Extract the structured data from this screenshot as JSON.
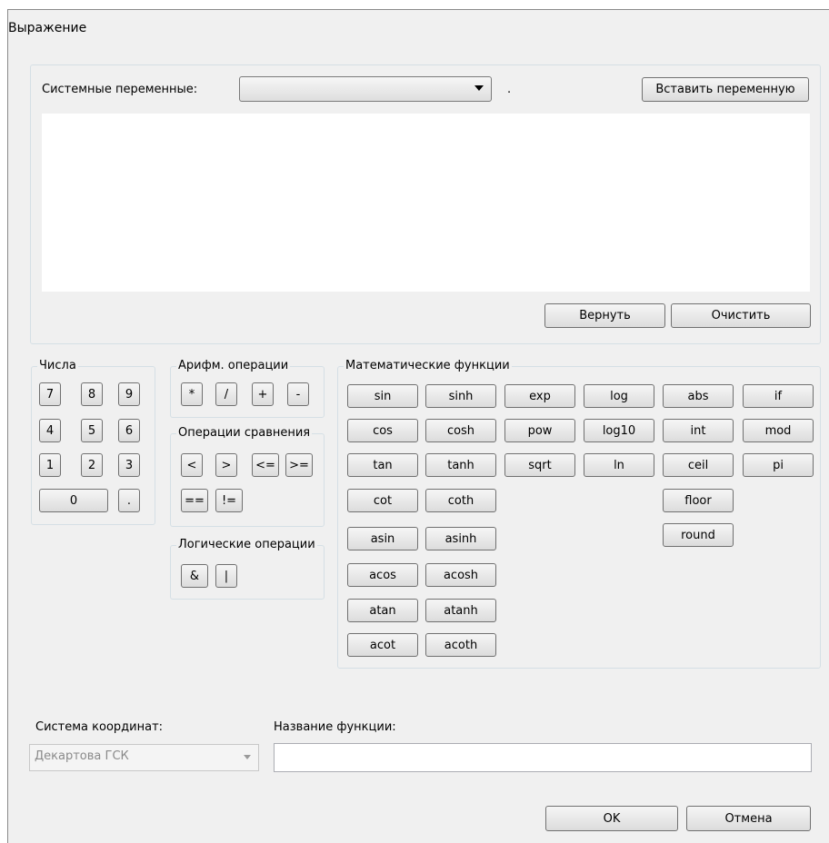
{
  "window": {
    "title": "Выражение"
  },
  "system_vars": {
    "label": "Системные переменные:",
    "selected": "",
    "dot": ".",
    "insert_button": "Вставить переменную"
  },
  "editor": {
    "value": ""
  },
  "actions": {
    "revert": "Вернуть",
    "clear": "Очистить"
  },
  "numbers": {
    "legend": "Числа",
    "keys": [
      "7",
      "8",
      "9",
      "4",
      "5",
      "6",
      "1",
      "2",
      "3",
      "0",
      "."
    ]
  },
  "arith": {
    "legend": "Арифм. операции",
    "keys": [
      "*",
      "/",
      "+",
      "-"
    ]
  },
  "compare": {
    "legend": "Операции сравнения",
    "keys": [
      "<",
      ">",
      "<=",
      ">=",
      "==",
      "!="
    ]
  },
  "logic": {
    "legend": "Логические операции",
    "keys": [
      "&",
      "|"
    ]
  },
  "math": {
    "legend": "Математические функции",
    "keys": [
      "sin",
      "sinh",
      "exp",
      "log",
      "abs",
      "if",
      "cos",
      "cosh",
      "pow",
      "log10",
      "int",
      "mod",
      "tan",
      "tanh",
      "sqrt",
      "ln",
      "ceil",
      "pi",
      "cot",
      "coth",
      "floor",
      "asin",
      "asinh",
      "round",
      "acos",
      "acosh",
      "atan",
      "atanh",
      "acot",
      "acoth"
    ]
  },
  "coords": {
    "label": "Система координат:",
    "selected": "Декартова ГСК"
  },
  "func_name": {
    "label": "Название функции:",
    "value": ""
  },
  "footer": {
    "ok": "OK",
    "cancel": "Отмена"
  }
}
